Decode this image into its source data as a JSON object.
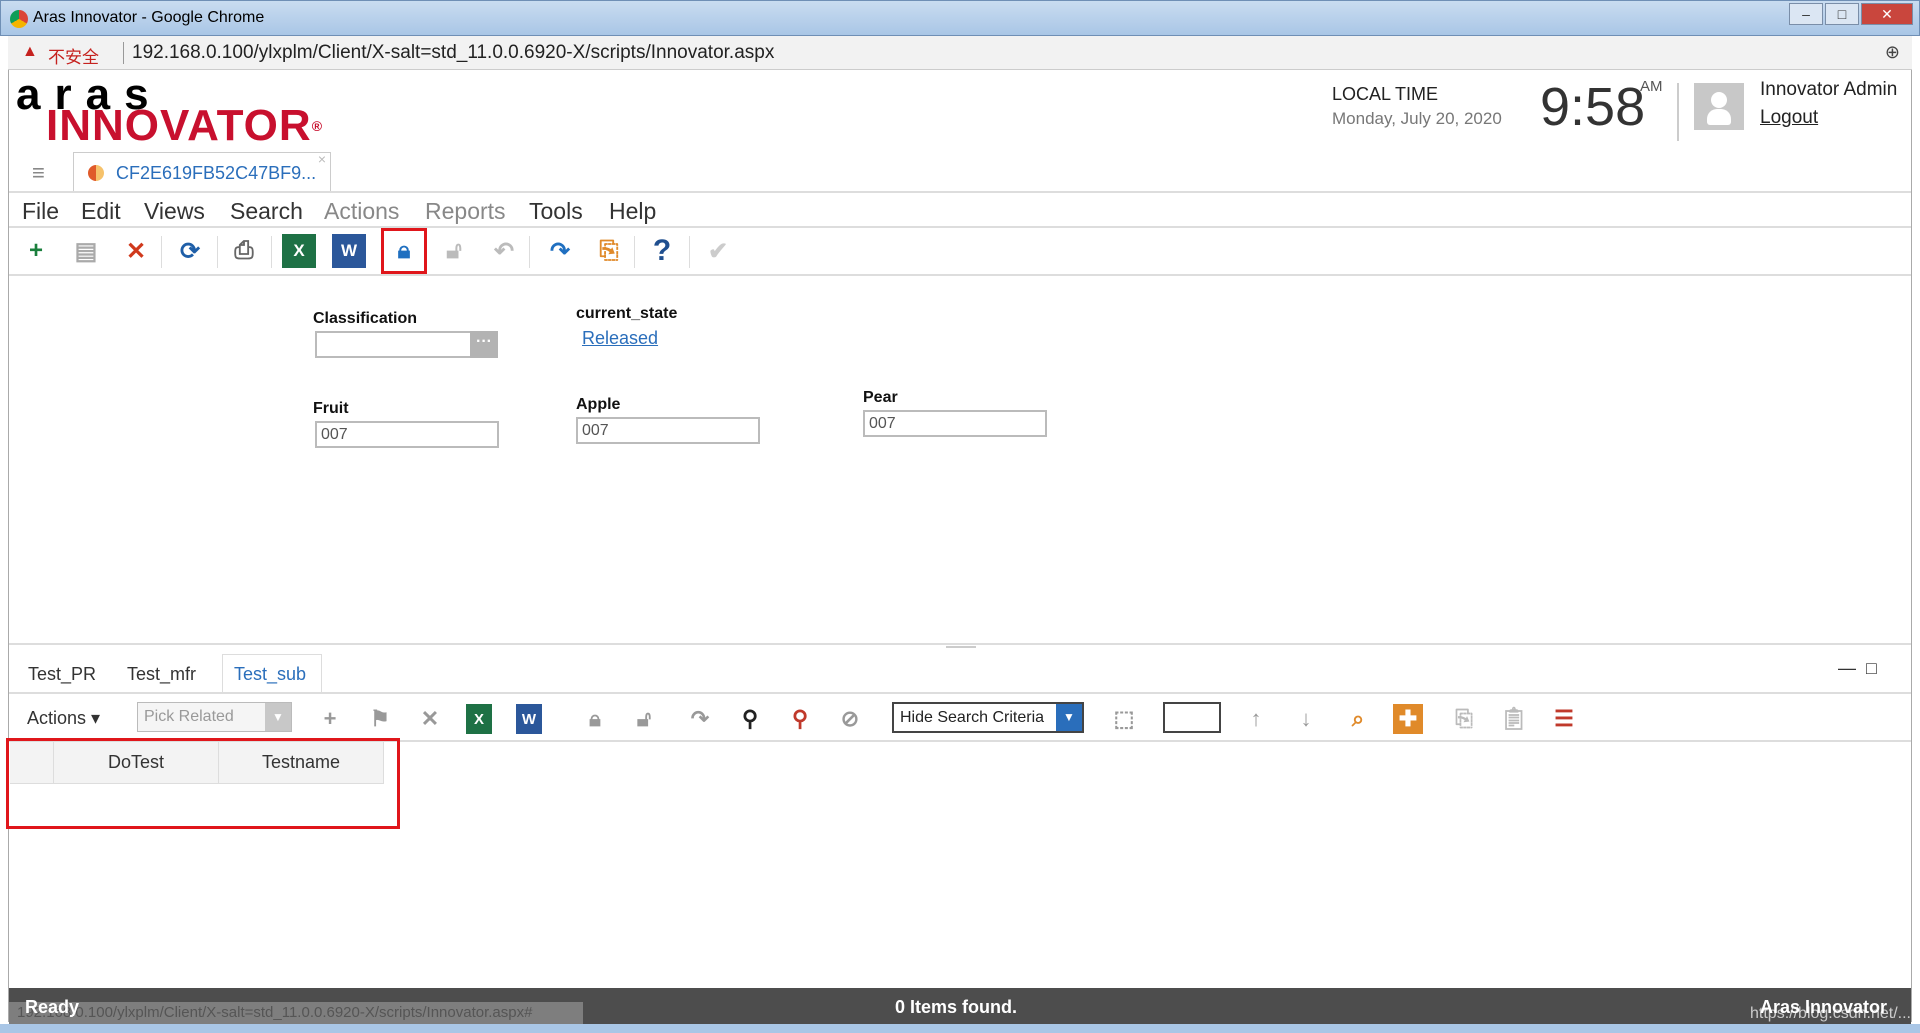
{
  "window": {
    "title": "Aras Innovator - Google Chrome"
  },
  "address_bar": {
    "security": "不安全",
    "url": "192.168.0.100/ylxplm/Client/X-salt=std_11.0.0.6920-X/scripts/Innovator.aspx"
  },
  "logo": {
    "line1": "aras",
    "line2": "INNOVATOR",
    "reg": "®"
  },
  "header": {
    "local_time_label": "LOCAL TIME",
    "date": "Monday, July 20, 2020",
    "time": "9:58",
    "ampm": "AM",
    "user": "Innovator Admin",
    "logout": "Logout"
  },
  "doc_tab": {
    "label": "CF2E619FB52C47BF9...",
    "close": "×"
  },
  "menu": [
    "File",
    "Edit",
    "Views",
    "Search",
    "Actions",
    "Reports",
    "Tools",
    "Help"
  ],
  "toolbar": {
    "icons": [
      "new-item",
      "save",
      "delete",
      "refresh",
      "print",
      "export-excel",
      "export-word",
      "lock",
      "unlock",
      "undo",
      "promote",
      "version",
      "help",
      "done"
    ],
    "highlighted": "lock"
  },
  "form": {
    "classification": {
      "label": "Classification",
      "value": ""
    },
    "current_state": {
      "label": "current_state",
      "value": "Released"
    },
    "fruit": {
      "label": "Fruit",
      "value": "007"
    },
    "apple": {
      "label": "Apple",
      "value": "007"
    },
    "pear": {
      "label": "Pear",
      "value": "007"
    }
  },
  "relationship_tabs": [
    "Test_PR",
    "Test_mfr",
    "Test_sub"
  ],
  "active_tab": "Test_sub",
  "relationship_toolbar": {
    "actions": "Actions ▾",
    "pick_related": "Pick Related",
    "search_mode": "Hide Search Criteria"
  },
  "grid": {
    "columns": [
      "",
      "DoTest",
      "Testname"
    ]
  },
  "status": {
    "ready": "Ready",
    "hover_url": "192.168.0.100/ylxplm/Client/X-salt=std_11.0.0.6920-X/scripts/Innovator.aspx#",
    "count": "0 Items found.",
    "brand": "Aras Innovator",
    "watermark": "https://blog.csdn.net/..."
  },
  "colors": {
    "brand_red": "#c8102e",
    "link_blue": "#2a6ebb",
    "highlight_red": "#e0161b",
    "status_bg": "#4d4d4d"
  }
}
